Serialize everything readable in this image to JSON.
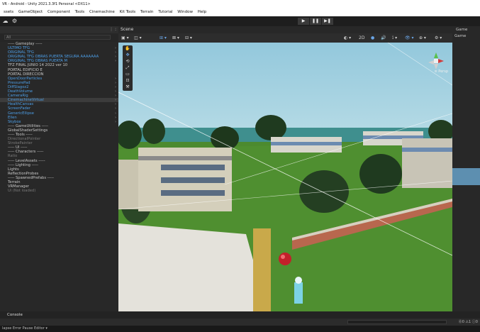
{
  "window": {
    "title": "VR - Android - Unity 2021.3.3f1 Personal <DX11>"
  },
  "menu": [
    "ssets",
    "GameObject",
    "Component",
    "Tools",
    "Cinemachine",
    "Kit Tools",
    "Terrain",
    "Tutorial",
    "Window",
    "Help"
  ],
  "toolbar": {
    "play": "▶",
    "pause": "❚❚",
    "step": "▶❚"
  },
  "hierarchy": {
    "header_right": "⋮ :",
    "search_placeholder": "All",
    "items": [
      {
        "label": "----- Gameplay -----",
        "style": "normal"
      },
      {
        "label": "ULTIMO TFG",
        "style": "blue"
      },
      {
        "label": "ORIGINAL TFG",
        "style": "blue"
      },
      {
        "label": "ORIGINAL TFG OBRAS PUERTA SEGURA AAAAAAA",
        "style": "blue"
      },
      {
        "label": "ORIGINAL TFG OBRAS PUERTA M",
        "style": "blue"
      },
      {
        "label": "TFZ FINAL JUNIO 14 2022 ver 10",
        "style": "normal"
      },
      {
        "label": "PORTAL EDIFICIO E",
        "style": "normal"
      },
      {
        "label": "PORTAL DIRECCION",
        "style": "normal"
      },
      {
        "label": "OpenDoorParticles",
        "style": "blue"
      },
      {
        "label": "PressurePad",
        "style": "blue"
      },
      {
        "label": "DiffSlagoz2",
        "style": "blue"
      },
      {
        "label": "DeathVolume",
        "style": "blue"
      },
      {
        "label": "CameraRig",
        "style": "blue"
      },
      {
        "label": "CinemachineVirtual",
        "style": "selected"
      },
      {
        "label": "HealthCanvas",
        "style": "blue"
      },
      {
        "label": "ScreenFader",
        "style": "blue"
      },
      {
        "label": "GenericEllipse",
        "style": "blue"
      },
      {
        "label": "Ellen",
        "style": "blue"
      },
      {
        "label": "Skybox",
        "style": "blue"
      },
      {
        "label": "----- GameUtilities -----",
        "style": "normal"
      },
      {
        "label": "GlobalShaderSettings",
        "style": "normal"
      },
      {
        "label": "----- Tools -----",
        "style": "normal"
      },
      {
        "label": "DirectionalPointer",
        "style": "gray"
      },
      {
        "label": "StrokePainter",
        "style": "gray"
      },
      {
        "label": "----- UI -----",
        "style": "normal"
      },
      {
        "label": "----- Characters -----",
        "style": "normal"
      },
      {
        "label": "Ratio",
        "style": "gray"
      },
      {
        "label": "----- LevelAssets -----",
        "style": "normal"
      },
      {
        "label": "----- Lighting -----",
        "style": "normal"
      },
      {
        "label": "Lights",
        "style": "normal"
      },
      {
        "label": "ReflectionProbes",
        "style": "normal"
      },
      {
        "label": "----- SpawnedPrefabs -----",
        "style": "normal"
      },
      {
        "label": "Terrain",
        "style": "normal"
      },
      {
        "label": "VRManager",
        "style": "normal"
      },
      {
        "label": "Ui (Not loaded)",
        "style": "gray"
      }
    ]
  },
  "scene": {
    "tab_label": "Scene",
    "tools_left": [
      "▣ ▾",
      "◫ ▾",
      "⊞ ▾",
      "⊠ ▾",
      "⊟ ▾"
    ],
    "tools_right": [
      "◐ ▾",
      "2D",
      "●",
      "🔊",
      "⟟ ▾",
      "👁 ▾",
      "⊕ ▾",
      "⚙ ▾"
    ],
    "gizmo_label": "≡ Persp"
  },
  "inspector": {
    "tab_label": "Game",
    "row_label": "Game"
  },
  "console": {
    "tab_label": "Console",
    "bar_label": "lapse  Error Pause  Editor ▾",
    "counts": "⓪0  ⚠1  ⓘ0"
  },
  "colors": {
    "accent_blue": "#4d9fe8",
    "panel": "#282828",
    "sky": "#7fb9d2",
    "grass": "#4c8a2f"
  }
}
